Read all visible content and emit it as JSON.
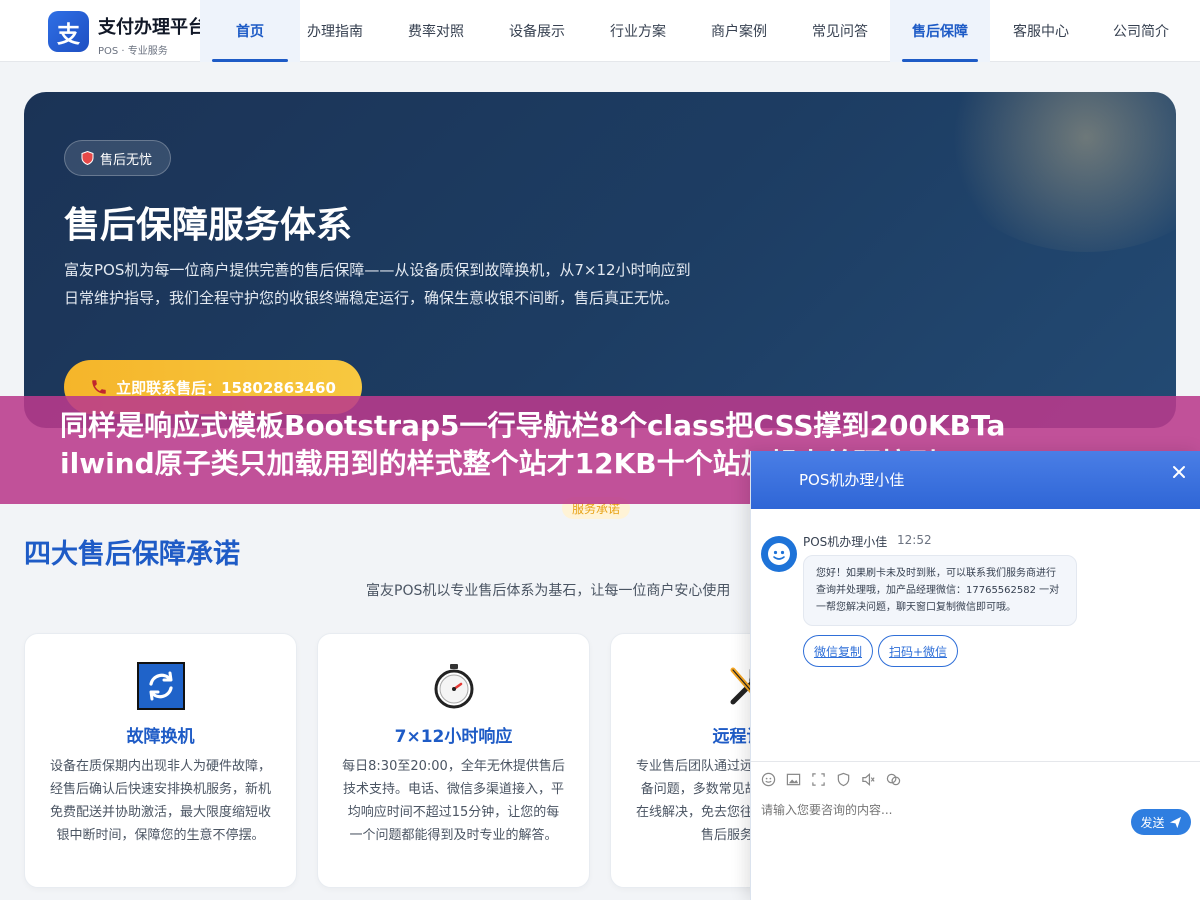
{
  "brand": {
    "logo_char": "支",
    "name": "支付办理平台",
    "subtitle": "POS · 专业服务"
  },
  "nav": [
    "首页",
    "办理指南",
    "费率对照",
    "设备展示",
    "行业方案",
    "商户案例",
    "常见问答",
    "售后保障",
    "客服中心",
    "公司简介"
  ],
  "nav_active": [
    "首页",
    "售后保障"
  ],
  "hero": {
    "badge": "售后无忧",
    "title": "售后保障服务体系",
    "desc": "富友POS机为每一位商户提供完善的售后保障——从设备质保到故障换机，从7×12小时响应到日常维护指导，我们全程守护您的收银终端稳定运行，确保生意收银不间断，售后真正无忧。",
    "cta": "立即联系售后：15802863460"
  },
  "overlay_banner": {
    "line1": "同样是响应式模板Bootstrap5一行导航栏8个class把CSS撑到200KBTa",
    "line2": "ilwind原子类只加载用到的样式整个站才12KB十个站加起来差距拉到1."
  },
  "section": {
    "tag": "服务承诺",
    "title": "四大售后保障承诺",
    "subtitle": "富友POS机以专业售后体系为基石，让每一位商户安心使用"
  },
  "cards": [
    {
      "icon": "refresh-icon",
      "title": "故障换机",
      "text": "设备在质保期内出现非人为硬件故障，经售后确认后快速安排换机服务，新机免费配送并协助激活，最大限度缩短收银中断时间，保障您的生意不停摆。"
    },
    {
      "icon": "stopwatch-icon",
      "title": "7×12小时响应",
      "text": "每日8:30至20:00，全年无休提供售后技术支持。电话、微信多渠道接入，平均响应时间不超过15分钟，让您的每一个问题都能得到及时专业的解答。"
    },
    {
      "icon": "tools-icon",
      "title": "远程诊断",
      "text": "专业售后团队通过远程方式快速定位设备问题，多数常见故障可在30分钟内在线解决，免去您往返奔波等待，提升售后服务效率。"
    }
  ],
  "chat": {
    "header_title": "POS机办理小佳",
    "agent_name": "POS机办理小佳",
    "time": "12:52",
    "message": "您好！如果刷卡未及时到账，可以联系我们服务商进行查询并处理哦，加产品经理微信：17765562582 一对一帮您解决问题，聊天窗口复制微信即可哦。",
    "quick_buttons": [
      "微信复制",
      "扫码+微信"
    ],
    "input_placeholder": "请输入您要咨询的内容...",
    "send_label": "发送",
    "toolbar_icons": [
      "emoji-icon",
      "image-icon",
      "screenshot-icon",
      "evaluate-icon",
      "voice-icon",
      "transfer-icon"
    ]
  },
  "colors": {
    "primary": "#1e5bc6",
    "hero_bg": "#1d3d63",
    "cta": "#f5b52a",
    "banner": "#ba3a8c",
    "chat_header": "#2f66d6"
  }
}
